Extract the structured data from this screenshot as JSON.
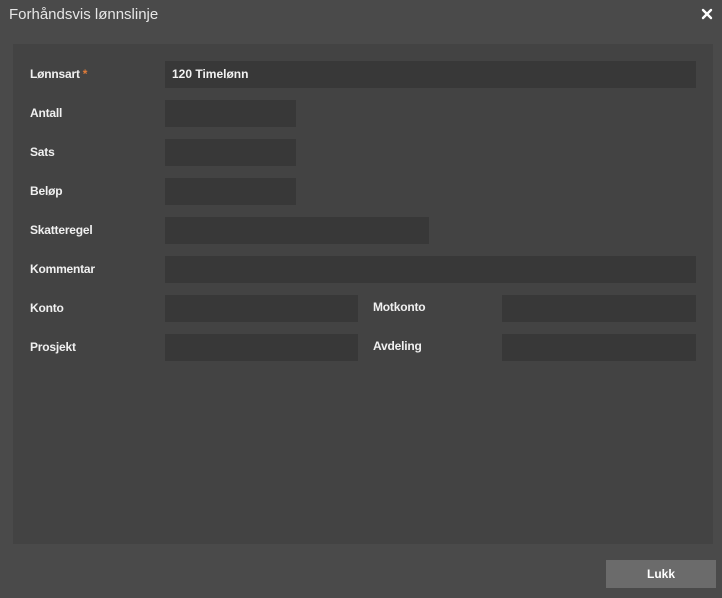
{
  "window": {
    "title": "Forhåndsvis lønnslinje",
    "close_icon": "close-icon"
  },
  "form": {
    "lonnsart": {
      "label": "Lønnsart",
      "required_mark": "*",
      "value": "120 Timelønn"
    },
    "antall": {
      "label": "Antall",
      "value": ""
    },
    "sats": {
      "label": "Sats",
      "value": ""
    },
    "belop": {
      "label": "Beløp",
      "value": ""
    },
    "skatteregel": {
      "label": "Skatteregel",
      "value": ""
    },
    "kommentar": {
      "label": "Kommentar",
      "value": ""
    },
    "konto": {
      "label": "Konto",
      "value": ""
    },
    "motkonto": {
      "label": "Motkonto",
      "value": ""
    },
    "prosjekt": {
      "label": "Prosjekt",
      "value": ""
    },
    "avdeling": {
      "label": "Avdeling",
      "value": ""
    }
  },
  "footer": {
    "close_label": "Lukk"
  },
  "colors": {
    "background": "#4a4a4a",
    "panel": "#434343",
    "field": "#383838",
    "required": "#e07b39",
    "button": "#6b6b6b"
  }
}
